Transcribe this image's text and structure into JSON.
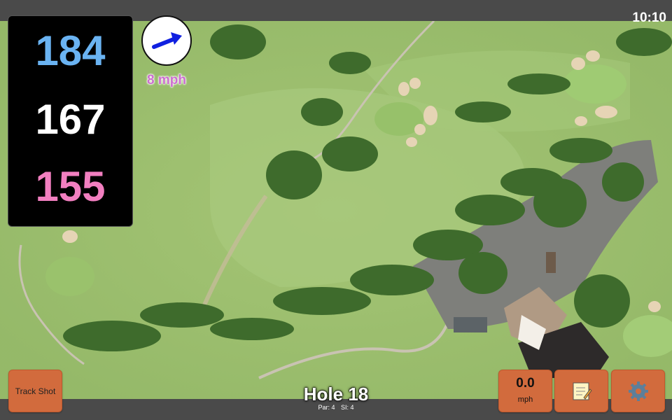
{
  "status": {
    "time": "10:10"
  },
  "yardages": {
    "back": "184",
    "middle": "167",
    "front": "155"
  },
  "wind": {
    "speed": "8 mph",
    "direction_icon": "arrow-icon"
  },
  "hole": {
    "title": "Hole 18",
    "par": "Par: 4",
    "si": "SI: 4"
  },
  "buttons": {
    "track_shot": "Track Shot",
    "speed_value": "0.0",
    "speed_unit": "mph",
    "notes_icon": "notepad-icon",
    "settings_icon": "gear-icon"
  },
  "colors": {
    "back_yardage": "#6ab3f2",
    "middle_yardage": "#ffffff",
    "front_yardage": "#f27fc0",
    "button": "#d26b3d",
    "wind_text": "#cc6fd0"
  }
}
